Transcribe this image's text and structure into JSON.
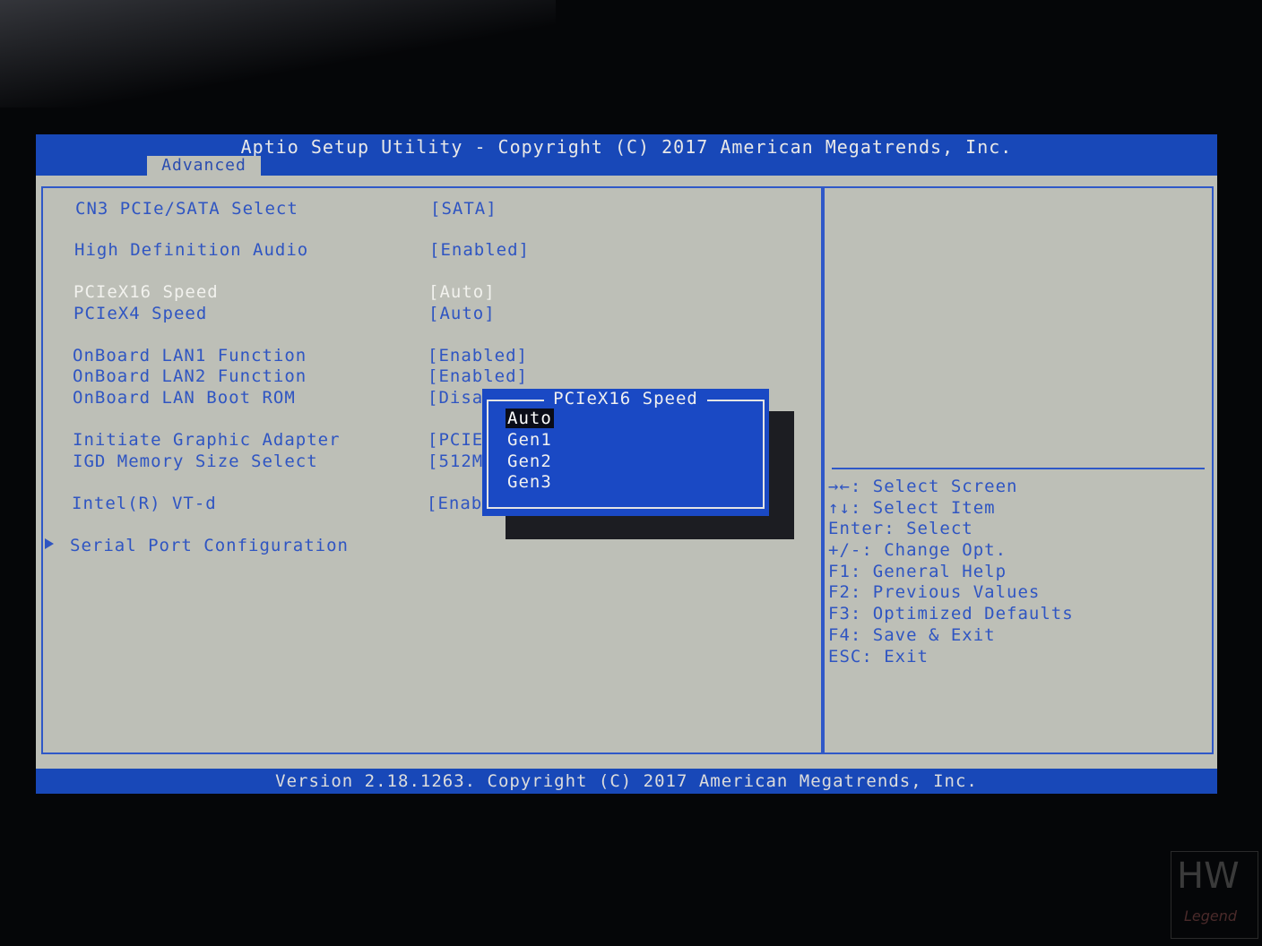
{
  "header": {
    "title": "Aptio Setup Utility - Copyright (C) 2017 American Megatrends, Inc.",
    "active_tab": "Advanced"
  },
  "settings": [
    {
      "label": "CN3 PCIe/SATA Select",
      "value": "[SATA]"
    },
    {
      "label": "High Definition Audio",
      "value": "[Enabled]"
    },
    {
      "label": "PCIeX16 Speed",
      "value": "[Auto]"
    },
    {
      "label": "PCIeX4 Speed",
      "value": "[Auto]"
    },
    {
      "label": "OnBoard LAN1 Function",
      "value": "[Enabled]"
    },
    {
      "label": "OnBoard LAN2 Function",
      "value": "[Enabled]"
    },
    {
      "label": "OnBoard LAN Boot ROM",
      "value": "[Disa"
    },
    {
      "label": "Initiate Graphic Adapter",
      "value": "[PCIE"
    },
    {
      "label": "IGD Memory Size Select",
      "value": "[512M"
    },
    {
      "label": "Intel(R) VT-d",
      "value": "[Enab"
    },
    {
      "label": "Serial Port Configuration",
      "value": ""
    }
  ],
  "popup": {
    "title": "PCIeX16 Speed",
    "options": [
      "Auto",
      "Gen1",
      "Gen2",
      "Gen3"
    ],
    "selected": "Auto"
  },
  "help": [
    "→←: Select Screen",
    "↑↓: Select Item",
    "Enter: Select",
    "+/-: Change Opt.",
    "F1: General Help",
    "F2: Previous Values",
    "F3: Optimized Defaults",
    "F4: Save & Exit",
    "ESC: Exit"
  ],
  "footer": "Version 2.18.1263. Copyright (C) 2017 American Megatrends, Inc.",
  "watermark": "HW Legend",
  "colors": {
    "bios_blue": "#1848b8",
    "panel_grey": "#bdbfb7",
    "text_blue": "#2f55c2",
    "highlight_white": "#f2f2ee"
  }
}
